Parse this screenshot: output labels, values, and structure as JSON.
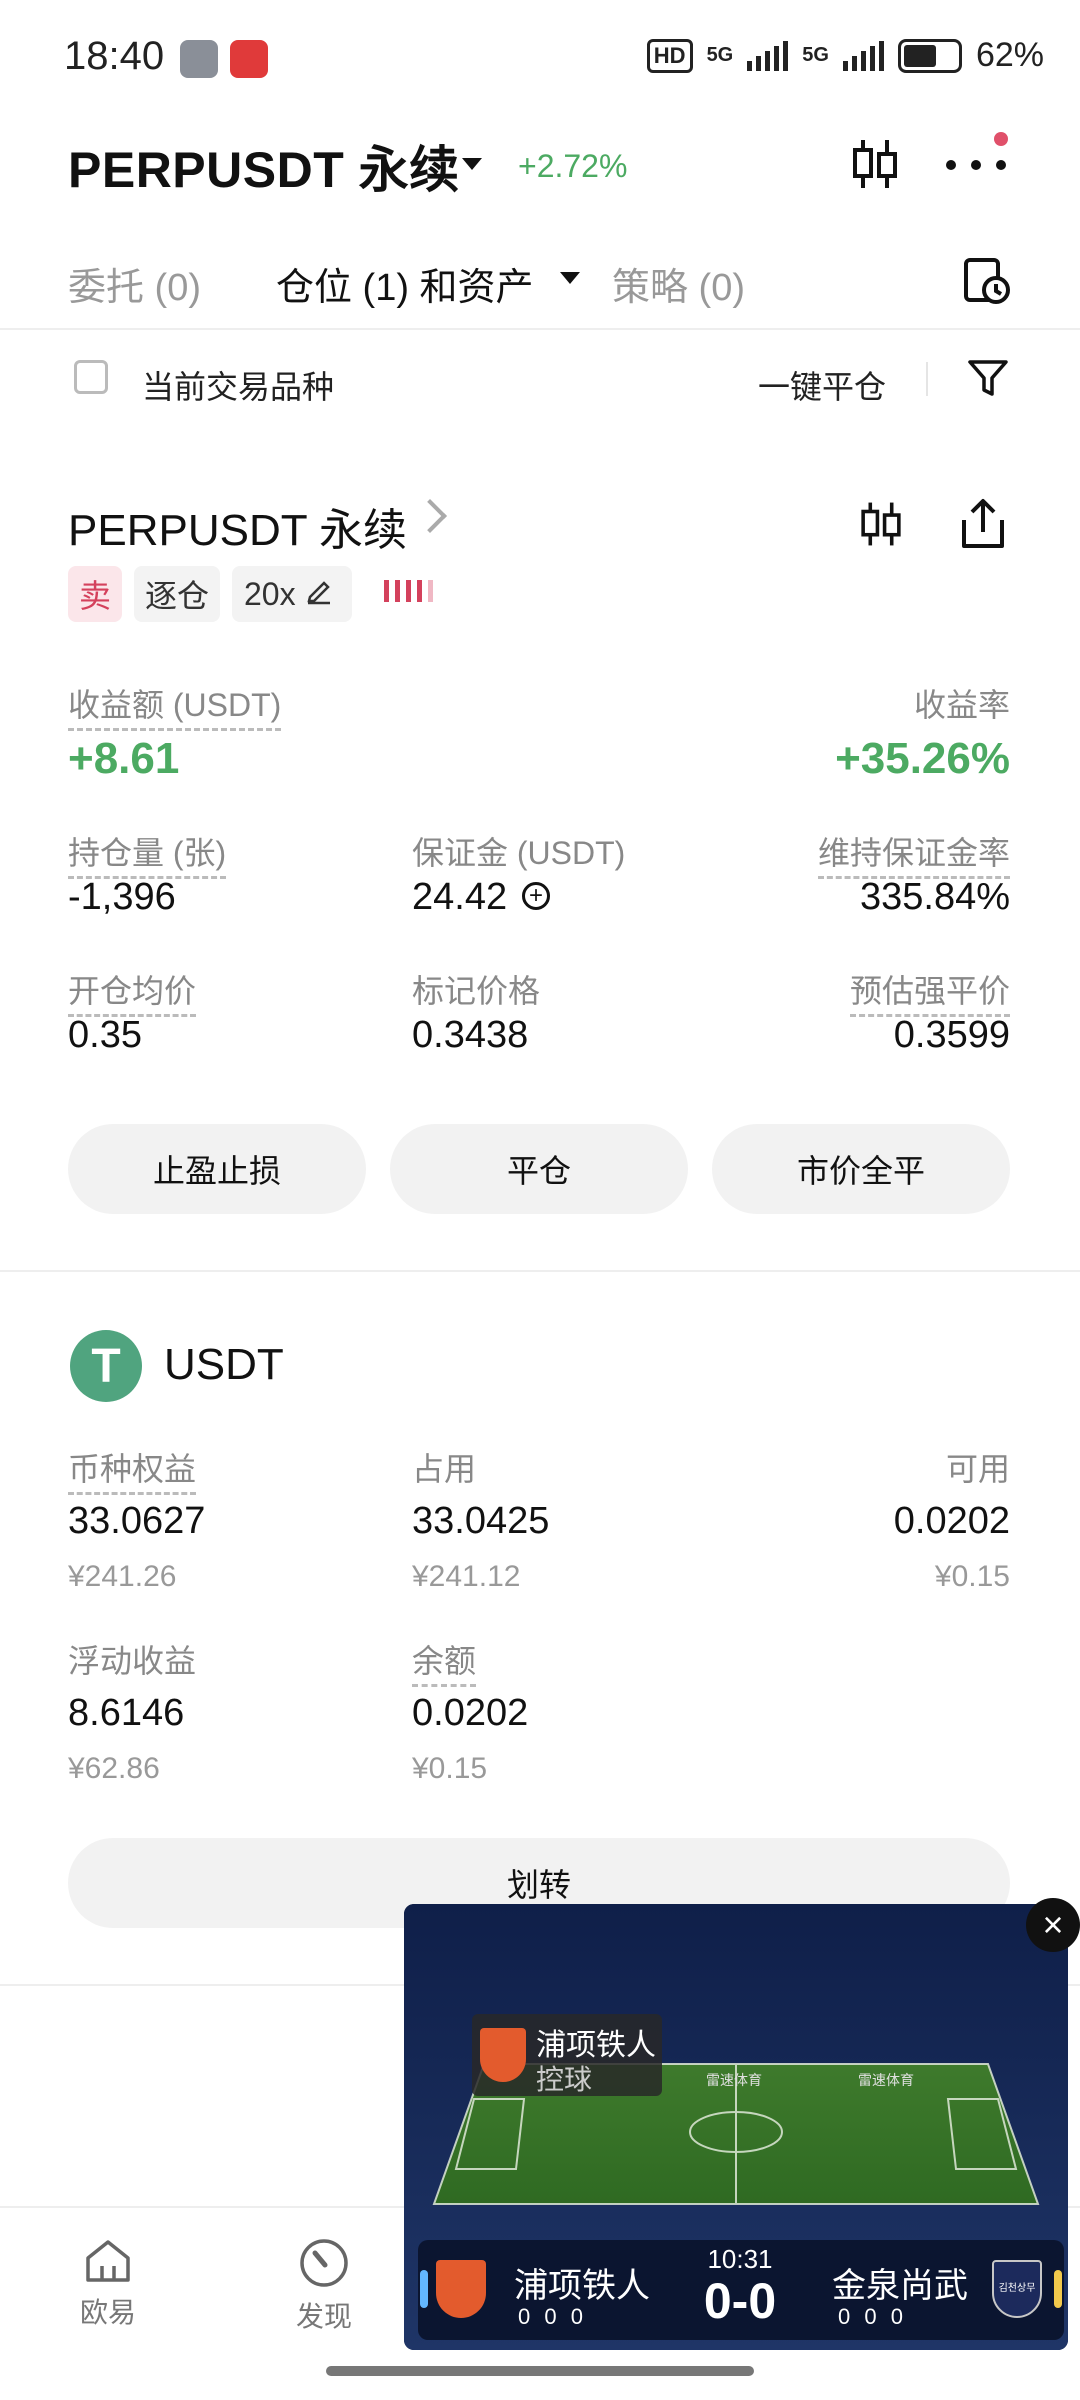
{
  "status_bar": {
    "time": "18:40",
    "hd_badge": "HD",
    "network_1": "5G",
    "network_2": "5G",
    "battery": "62%"
  },
  "header": {
    "pair_title": "PERPUSDT 永续",
    "change": "+2.72%"
  },
  "tabs": [
    {
      "label": "委托 (0)"
    },
    {
      "label": "仓位 (1) 和资产"
    },
    {
      "label": "策略 (0)"
    }
  ],
  "filter_bar": {
    "current_pair_label": "当前交易品种",
    "close_all_label": "一键平仓"
  },
  "position": {
    "title": "PERPUSDT 永续",
    "side_tag": "卖",
    "margin_mode_tag": "逐仓",
    "leverage_tag": "20x",
    "pnl_label": "收益额 (USDT)",
    "pnl_value": "+8.61",
    "roi_label": "收益率",
    "roi_value": "+35.26%",
    "size_label": "持仓量 (张)",
    "size_value": "-1,396",
    "margin_label": "保证金 (USDT)",
    "margin_value": "24.42",
    "mmr_label": "维持保证金率",
    "mmr_value": "335.84%",
    "entry_label": "开仓均价",
    "entry_value": "0.35",
    "mark_label": "标记价格",
    "mark_value": "0.3438",
    "liq_label": "预估强平价",
    "liq_value": "0.3599",
    "btn_tpsl": "止盈止损",
    "btn_close": "平仓",
    "btn_market_close": "市价全平"
  },
  "asset": {
    "symbol_icon_text": "T",
    "currency": "USDT",
    "equity_label": "币种权益",
    "equity_value": "33.0627",
    "equity_cny": "¥241.26",
    "occupied_label": "占用",
    "occupied_value": "33.0425",
    "occupied_cny": "¥241.12",
    "available_label": "可用",
    "available_value": "0.0202",
    "available_cny": "¥0.15",
    "floating_label": "浮动收益",
    "floating_value": "8.6146",
    "floating_cny": "¥62.86",
    "balance_label": "余额",
    "balance_value": "0.0202",
    "balance_cny": "¥0.15",
    "transfer_label": "划转"
  },
  "bottom_nav": [
    {
      "label": "欧易",
      "icon": "home-icon"
    },
    {
      "label": "发现",
      "icon": "discover-icon"
    }
  ],
  "video_overlay": {
    "possession_team": "浦项铁人",
    "possession_text": "控球",
    "ad_text": "雷速体育",
    "match_time": "10:31",
    "home_team": "浦项铁人",
    "away_team": "金泉尚武",
    "score": "0-0",
    "home_stats": "0 0 0",
    "away_stats": "0 0 0",
    "away_logo_text": "김천상무"
  },
  "colors": {
    "green": "#4caa62",
    "red": "#d4415c",
    "usdt": "#50a47f"
  }
}
